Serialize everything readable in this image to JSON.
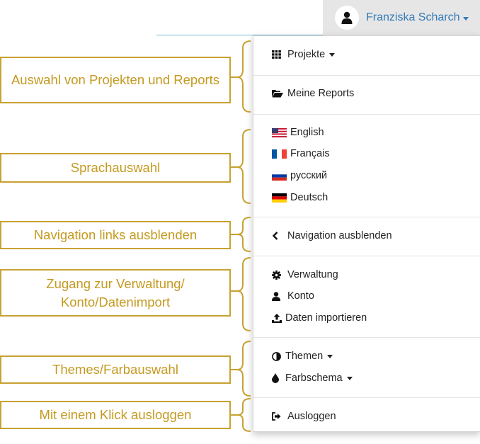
{
  "user": {
    "name": "Franziska Scharch"
  },
  "menu": {
    "projects": "Projekte",
    "reports": "Meine Reports",
    "languages": [
      "English",
      "Français",
      "русский",
      "Deutsch"
    ],
    "hide_nav": "Navigation ausblenden",
    "admin": "Verwaltung",
    "account": "Konto",
    "import": "Daten importieren",
    "themes": "Themen",
    "colorscheme": "Farbschema",
    "logout": "Ausloggen"
  },
  "callouts": {
    "projects": "Auswahl von Projekten und Reports",
    "language": "Sprachauswahl",
    "navigation": "Navigation links ausblenden",
    "admin": "Zugang zur Verwaltung/ Konto/Datenimport",
    "themes": "Themes/Farbauswahl",
    "logout": "Mit einem Klick ausloggen"
  },
  "colors": {
    "accent": "#c8a131",
    "link": "#337ab7"
  }
}
